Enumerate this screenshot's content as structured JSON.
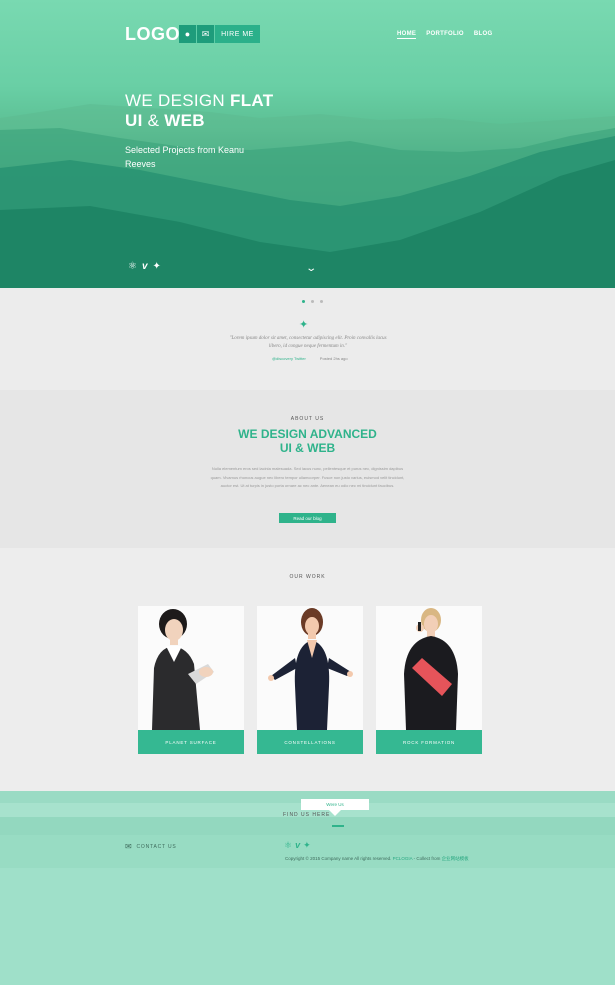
{
  "header": {
    "logo": "LOGO",
    "location_icon": "location-pin-icon",
    "mail_icon": "envelope-icon",
    "hire_label": "HIRE ME",
    "nav": [
      "HOME",
      "PORTFOLIO",
      "BLOG"
    ]
  },
  "hero": {
    "line1_light": "WE DESIGN ",
    "line1_bold": "FLAT",
    "line2_bold1": "UI",
    "line2_light": " & ",
    "line2_bold2": "WEB",
    "subtitle": "Selected Projects from Keanu Reeves",
    "social_icons": [
      "dribbble-icon",
      "vimeo-icon",
      "twitter-icon"
    ],
    "scroll_icon": "chevron-down-icon"
  },
  "testimonial": {
    "icon": "twitter-icon",
    "quote": "\"Lorem ipsum dolor sit amet, consectetur adipiscing elit. Proin convallis lacus libero, id congue neque fermentum in.\"",
    "handle": "@discovery Twitter",
    "posted": "Posted 2hs ago"
  },
  "about": {
    "kicker": "ABOUT US",
    "title_line1": "WE DESIGN ADVANCED",
    "title_line2": "UI & WEB",
    "text": "Nulla elementum eros sed lacinia malesuada. Sed lacus nunc, pellentesque et purus nec, dignissim dapibus quam. Vivamus rhoncus augue nec libero tempor ullamcorper. Fusce non justo varius, euismod velit tincidunt, auctor est. Ut at turpis in justo porta ornare ac nec ante. Aenean eu odio nec mi tincidunt faucibus.",
    "button": "Read our blog"
  },
  "work": {
    "kicker": "OUR WORK",
    "items": [
      {
        "caption": "PLANET SURFACE"
      },
      {
        "caption": "CONSTELLATIONS"
      },
      {
        "caption": "ROCK FORMATION"
      }
    ]
  },
  "map": {
    "pin_label": "Were Us",
    "find_label": "FIND US HERE"
  },
  "footer": {
    "contact_label": "CONTACT US",
    "social_icons": [
      "dribbble-icon",
      "vimeo-icon",
      "twitter-icon"
    ],
    "copyright": "Copyright © 2015 Company name All rights reserved.",
    "link1": "PCLOGIA",
    "link_sep": " - Collect from ",
    "link2": "企业网站模板"
  }
}
